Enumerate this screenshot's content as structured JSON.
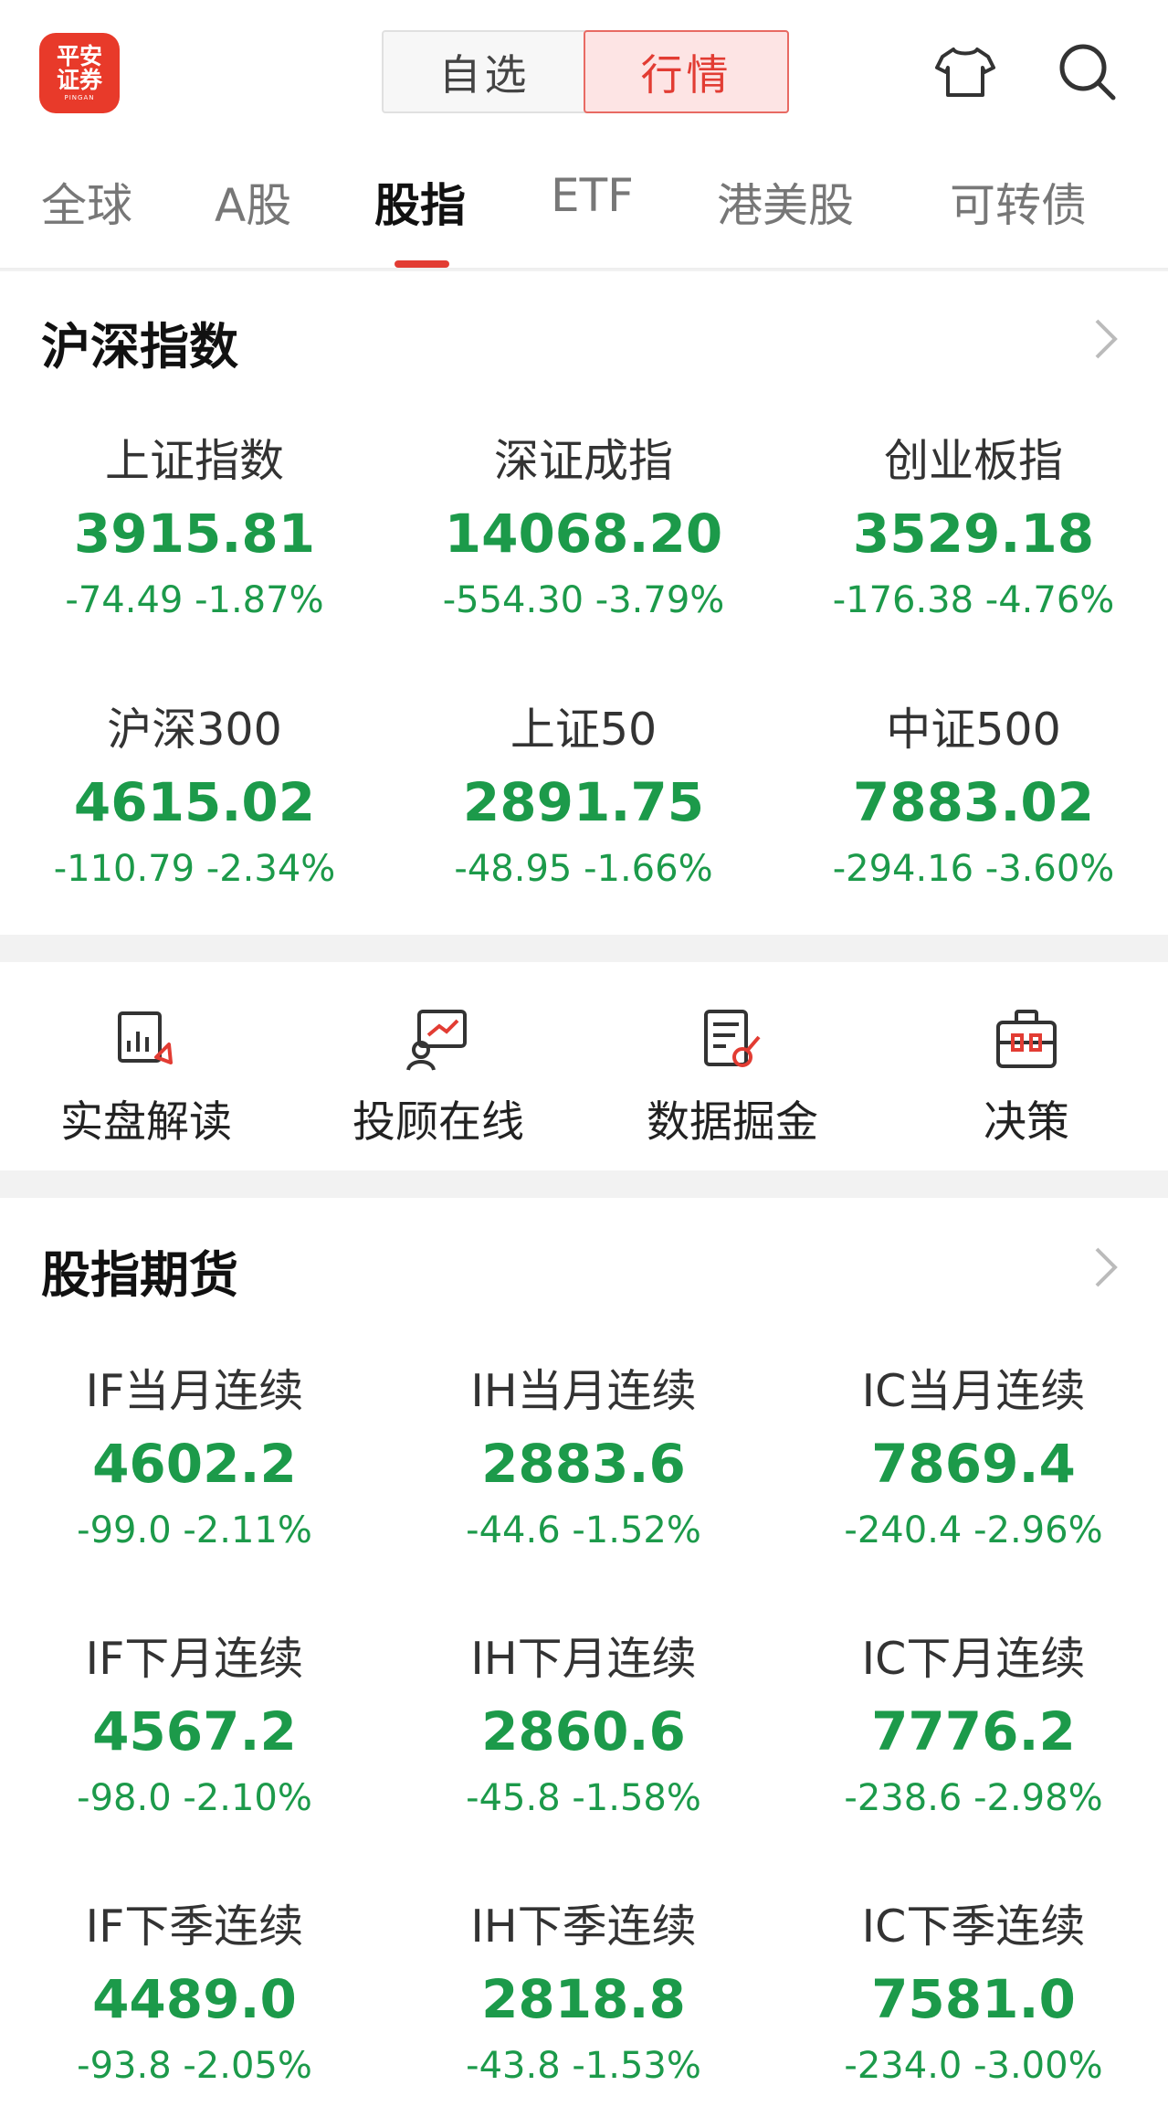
{
  "header": {
    "logo_line1": "平安",
    "logo_line2": "证券",
    "logo_sub": "PINGAN",
    "segments": [
      "自选",
      "行情"
    ],
    "active_segment": "行情"
  },
  "tabs": [
    "全球",
    "A股",
    "股指",
    "ETF",
    "港美股",
    "可转债"
  ],
  "active_tab": "股指",
  "colors": {
    "down": "#1c9a4a",
    "accent": "#e23c33"
  },
  "indices": {
    "title": "沪深指数",
    "items": [
      {
        "name": "上证指数",
        "value": "3915.81",
        "change": "-74.49 -1.87%"
      },
      {
        "name": "深证成指",
        "value": "14068.20",
        "change": "-554.30 -3.79%"
      },
      {
        "name": "创业板指",
        "value": "3529.18",
        "change": "-176.38 -4.76%"
      },
      {
        "name": "沪深300",
        "value": "4615.02",
        "change": "-110.79 -2.34%"
      },
      {
        "name": "上证50",
        "value": "2891.75",
        "change": "-48.95 -1.66%"
      },
      {
        "name": "中证500",
        "value": "7883.02",
        "change": "-294.16 -3.60%"
      }
    ]
  },
  "shortcuts": [
    {
      "label": "实盘解读",
      "icon": "chart-report-icon"
    },
    {
      "label": "投顾在线",
      "icon": "advisor-online-icon"
    },
    {
      "label": "数据掘金",
      "icon": "data-mining-icon"
    },
    {
      "label": "决策",
      "icon": "briefcase-icon"
    }
  ],
  "futures": {
    "title": "股指期货",
    "items": [
      {
        "name": "IF当月连续",
        "value": "4602.2",
        "change": "-99.0 -2.11%"
      },
      {
        "name": "IH当月连续",
        "value": "2883.6",
        "change": "-44.6 -1.52%"
      },
      {
        "name": "IC当月连续",
        "value": "7869.4",
        "change": "-240.4 -2.96%"
      },
      {
        "name": "IF下月连续",
        "value": "4567.2",
        "change": "-98.0 -2.10%"
      },
      {
        "name": "IH下月连续",
        "value": "2860.6",
        "change": "-45.8 -1.58%"
      },
      {
        "name": "IC下月连续",
        "value": "7776.2",
        "change": "-238.6 -2.98%"
      },
      {
        "name": "IF下季连续",
        "value": "4489.0",
        "change": "-93.8 -2.05%"
      },
      {
        "name": "IH下季连续",
        "value": "2818.8",
        "change": "-43.8 -1.53%"
      },
      {
        "name": "IC下季连续",
        "value": "7581.0",
        "change": "-234.0 -3.00%"
      }
    ]
  }
}
